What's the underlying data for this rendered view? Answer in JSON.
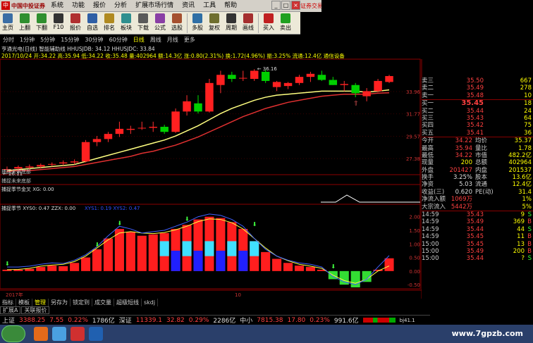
{
  "app": {
    "logo_text": "中国中投证券",
    "broker_badge": "证券交易"
  },
  "menu": [
    "系统",
    "功能",
    "报价",
    "分析",
    "扩展市场行情",
    "资讯",
    "工具",
    "帮助"
  ],
  "toolbar": [
    {
      "label": "主页",
      "color": "#3a6ea5",
      "icon": "home-icon"
    },
    {
      "label": "上翻",
      "color": "#2f8f2f",
      "icon": "page-up-icon"
    },
    {
      "label": "下翻",
      "color": "#2f8f2f",
      "icon": "page-down-icon"
    },
    {
      "label": "F10",
      "color": "#333",
      "icon": "f10-icon"
    },
    {
      "label": "报价",
      "color": "#b03030",
      "icon": "quote-icon"
    },
    {
      "label": "自选",
      "color": "#2f5fa5",
      "icon": "watchlist-icon"
    },
    {
      "label": "排名",
      "color": "#b08a20",
      "icon": "ranking-icon"
    },
    {
      "label": "板块",
      "color": "#2f8f8f",
      "icon": "sector-icon"
    },
    {
      "label": "下载",
      "color": "#5a5a5a",
      "icon": "download-icon"
    },
    {
      "label": "公式",
      "color": "#8a3fa5",
      "icon": "formula-icon"
    },
    {
      "label": "选股",
      "color": "#a5502f",
      "icon": "stock-picker-icon"
    },
    {
      "label": "多股",
      "color": "#2f6fa5",
      "icon": "multi-stock-icon"
    },
    {
      "label": "复权",
      "color": "#6f6f2f",
      "icon": "adjust-icon"
    },
    {
      "label": "周期",
      "color": "#333",
      "icon": "period-icon"
    },
    {
      "label": "画线",
      "color": "#a52f2f",
      "icon": "draw-line-icon"
    },
    {
      "label": "买入",
      "color": "#c02020",
      "icon": "buy-icon"
    },
    {
      "label": "卖出",
      "color": "#20a020",
      "icon": "sell-icon"
    }
  ],
  "periods": [
    "分时",
    "1分钟",
    "5分钟",
    "15分钟",
    "30分钟",
    "60分钟",
    "日线",
    "周线",
    "月线",
    "更多"
  ],
  "active_period": "日线",
  "chart_header": {
    "title_line": "亨通光电(日线) 智能辅助线 HHUSJDB: 34.12  HHUSJDC: 33.84",
    "indicator_line": "2017/10/24 开:34.22 高:35.94 低:34.22 收:35.48 量:402964 额:14.3亿 涨:0.80(2.31%) 换:1.72(4.96%) 振:3.25% 流通:12.4亿 通信设备"
  },
  "price_axis": [
    "33.96",
    "31.77",
    "29.57",
    "27.38"
  ],
  "price_labels": {
    "high": "36.16",
    "low": "26.11"
  },
  "panels": {
    "vol_title": "捕捉未来底部",
    "vol_sub": "捕捉未来底部",
    "golden_title": "捕捉季节金叉 XG: 0.00",
    "season_title": "捕捉季节 XYS0: 0.47  ZZX: 0.00",
    "season_more": "XYS1: 0.19  XYS2: 0.47"
  },
  "osc_axis": [
    "2.00",
    "1.50",
    "1.00",
    "0.50",
    "0.00",
    "-0.50"
  ],
  "time_axis": {
    "year": "2017年",
    "month": "10",
    "period_label": "日线"
  },
  "chart_data": [
    {
      "type": "candlestick",
      "title": "亨通光电(日线)",
      "ylim": [
        25.8,
        37.0
      ],
      "candles": [
        {
          "o": 26.3,
          "h": 26.6,
          "l": 26.0,
          "c": 26.35
        },
        {
          "o": 26.4,
          "h": 26.7,
          "l": 26.2,
          "c": 26.55
        },
        {
          "o": 26.5,
          "h": 26.8,
          "l": 26.3,
          "c": 26.6
        },
        {
          "o": 26.6,
          "h": 26.9,
          "l": 26.4,
          "c": 26.75
        },
        {
          "o": 26.8,
          "h": 27.0,
          "l": 26.6,
          "c": 26.85
        },
        {
          "o": 26.9,
          "h": 27.2,
          "l": 26.7,
          "c": 27.0
        },
        {
          "o": 27.0,
          "h": 27.3,
          "l": 26.8,
          "c": 27.1
        },
        {
          "o": 27.1,
          "h": 29.2,
          "l": 27.0,
          "c": 29.0
        },
        {
          "o": 29.0,
          "h": 29.6,
          "l": 28.6,
          "c": 29.3
        },
        {
          "o": 29.3,
          "h": 30.0,
          "l": 29.0,
          "c": 29.8
        },
        {
          "o": 29.8,
          "h": 31.0,
          "l": 29.5,
          "c": 30.3
        },
        {
          "o": 30.2,
          "h": 30.6,
          "l": 29.8,
          "c": 30.3
        },
        {
          "o": 30.4,
          "h": 31.0,
          "l": 30.2,
          "c": 30.4
        },
        {
          "o": 30.4,
          "h": 31.0,
          "l": 30.0,
          "c": 30.5
        },
        {
          "o": 30.5,
          "h": 30.7,
          "l": 29.8,
          "c": 30.0
        },
        {
          "o": 30.0,
          "h": 32.3,
          "l": 29.9,
          "c": 32.0
        },
        {
          "o": 32.0,
          "h": 33.6,
          "l": 31.6,
          "c": 33.0
        },
        {
          "o": 32.8,
          "h": 33.6,
          "l": 31.8,
          "c": 32.0
        },
        {
          "o": 32.0,
          "h": 35.2,
          "l": 31.9,
          "c": 34.8
        },
        {
          "o": 34.6,
          "h": 36.0,
          "l": 33.8,
          "c": 35.6
        },
        {
          "o": 35.6,
          "h": 35.9,
          "l": 34.9,
          "c": 35.2
        },
        {
          "o": 35.3,
          "h": 36.0,
          "l": 35.0,
          "c": 35.3
        },
        {
          "o": 35.2,
          "h": 36.16,
          "l": 35.0,
          "c": 36.0
        },
        {
          "o": 35.9,
          "h": 36.1,
          "l": 34.8,
          "c": 35.0
        },
        {
          "o": 34.4,
          "h": 35.0,
          "l": 34.0,
          "c": 34.9
        },
        {
          "o": 34.5,
          "h": 34.9,
          "l": 34.2,
          "c": 34.8
        },
        {
          "o": 34.8,
          "h": 35.6,
          "l": 34.6,
          "c": 35.4
        },
        {
          "o": 35.4,
          "h": 35.9,
          "l": 34.9,
          "c": 35.7
        },
        {
          "o": 35.6,
          "h": 36.0,
          "l": 35.0,
          "c": 35.1
        },
        {
          "o": 35.1,
          "h": 35.4,
          "l": 34.6,
          "c": 34.6
        },
        {
          "o": 34.6,
          "h": 35.0,
          "l": 34.0,
          "c": 34.7
        },
        {
          "o": 34.6,
          "h": 34.8,
          "l": 33.4,
          "c": 33.8
        },
        {
          "o": 33.5,
          "h": 34.3,
          "l": 33.0,
          "c": 34.0
        },
        {
          "o": 34.0,
          "h": 35.2,
          "l": 33.9,
          "c": 35.0
        },
        {
          "o": 34.9,
          "h": 35.6,
          "l": 34.8,
          "c": 35.48
        }
      ],
      "ma_series": [
        {
          "name": "HHUSJDB",
          "color": "#ffff80",
          "values": [
            26.2,
            26.3,
            26.4,
            26.5,
            26.6,
            26.7,
            26.8,
            27.1,
            27.4,
            27.7,
            28.0,
            28.3,
            28.6,
            28.9,
            29.2,
            29.6,
            30.1,
            30.6,
            31.2,
            31.8,
            32.3,
            32.7,
            33.1,
            33.4,
            33.6,
            33.7,
            33.8,
            33.9,
            34.0,
            34.0,
            34.0,
            34.0,
            33.9,
            34.0,
            34.12
          ]
        },
        {
          "name": "HHUSJDC",
          "color": "#e03030",
          "values": [
            26.1,
            26.2,
            26.2,
            26.3,
            26.4,
            26.5,
            26.6,
            26.8,
            27.0,
            27.2,
            27.4,
            27.6,
            27.9,
            28.1,
            28.4,
            28.7,
            29.1,
            29.5,
            30.0,
            30.5,
            31.0,
            31.5,
            31.9,
            32.3,
            32.6,
            32.9,
            33.1,
            33.3,
            33.5,
            33.6,
            33.7,
            33.7,
            33.7,
            33.8,
            33.84
          ]
        }
      ]
    },
    {
      "type": "bar",
      "title": "捕捉季节",
      "ylim": [
        -0.6,
        2.2
      ],
      "values": [
        0.05,
        0.05,
        0.08,
        0.15,
        0.2,
        0.18,
        0.3,
        0.5,
        0.8,
        1.2,
        1.55,
        1.45,
        1.3,
        1.35,
        1.4,
        1.55,
        1.7,
        1.9,
        2.0,
        1.95,
        1.8,
        1.55,
        1.1,
        0.7,
        0.45,
        0.3,
        0.2,
        0.15,
        0.05,
        -0.3,
        -0.5,
        -0.6,
        -0.4,
        0.05,
        0.47
      ],
      "line": [
        0.05,
        0.06,
        0.1,
        0.18,
        0.22,
        0.25,
        0.35,
        0.55,
        0.85,
        1.15,
        1.4,
        1.45,
        1.4,
        1.38,
        1.42,
        1.52,
        1.65,
        1.82,
        1.92,
        1.9,
        1.78,
        1.55,
        1.2,
        0.85,
        0.55,
        0.38,
        0.25,
        0.18,
        0.1,
        -0.15,
        -0.35,
        -0.45,
        -0.3,
        0.0,
        0.19
      ]
    }
  ],
  "quote": {
    "asks": [
      {
        "l": "卖三",
        "p": "35.50",
        "v": "667"
      },
      {
        "l": "卖二",
        "p": "35.49",
        "v": "278"
      },
      {
        "l": "卖一",
        "p": "35.48",
        "v": "10"
      }
    ],
    "bids": [
      {
        "l": "买一",
        "p": "35.45",
        "v": "18"
      },
      {
        "l": "买二",
        "p": "35.44",
        "v": "24"
      },
      {
        "l": "买三",
        "p": "35.43",
        "v": "64"
      },
      {
        "l": "买四",
        "p": "35.42",
        "v": "75"
      },
      {
        "l": "买五",
        "p": "35.41",
        "v": "36"
      }
    ],
    "stats": [
      [
        {
          "l": "今开",
          "v": "34.22",
          "c": "red"
        },
        {
          "l": "均价",
          "v": "35.37",
          "c": "red"
        }
      ],
      [
        {
          "l": "最高",
          "v": "35.94",
          "c": "red"
        },
        {
          "l": "量比",
          "v": "1.78",
          "c": "red"
        }
      ],
      [
        {
          "l": "最低",
          "v": "34.22",
          "c": "red"
        },
        {
          "l": "市值",
          "v": "482.2亿",
          "c": "wht"
        }
      ],
      [
        {
          "l": "现量",
          "v": "200",
          "c": "yel"
        },
        {
          "l": "总额",
          "v": "402964",
          "c": "yel"
        }
      ],
      [
        {
          "l": "外盘",
          "v": "201427",
          "c": "red"
        },
        {
          "l": "内盘",
          "v": "201537",
          "c": "grn"
        }
      ],
      [
        {
          "l": "换手",
          "v": "3.25%",
          "c": "wht"
        },
        {
          "l": "股本",
          "v": "13.6亿",
          "c": "wht"
        }
      ],
      [
        {
          "l": "净资",
          "v": "5.03",
          "c": "wht"
        },
        {
          "l": "流通",
          "v": "12.4亿",
          "c": "wht"
        }
      ],
      [
        {
          "l": "收益(三)",
          "v": "0.620",
          "c": "wht"
        },
        {
          "l": "PE(动)",
          "v": "31.4",
          "c": "wht"
        }
      ],
      [
        {
          "l": "净流入额",
          "v": "1069万",
          "c": "red"
        },
        {
          "l": "",
          "v": "1%",
          "c": "red"
        }
      ],
      [
        {
          "l": "大宗流入",
          "v": "5442万",
          "c": "red"
        },
        {
          "l": "",
          "v": "5%",
          "c": "red"
        }
      ]
    ],
    "ticks": [
      {
        "t": "14:59",
        "p": "35.43",
        "v": "9",
        "s": "S"
      },
      {
        "t": "14:59",
        "p": "35.49",
        "v": "369",
        "s": "B"
      },
      {
        "t": "14:59",
        "p": "35.44",
        "v": "44",
        "s": "S"
      },
      {
        "t": "14:59",
        "p": "35.45",
        "v": "11",
        "s": "B"
      },
      {
        "t": "15:00",
        "p": "35.45",
        "v": "13",
        "s": "B"
      },
      {
        "t": "15:00",
        "p": "35.49",
        "v": "200",
        "s": "B"
      },
      {
        "t": "15:00",
        "p": "35.44",
        "v": "?",
        "s": "S"
      }
    ]
  },
  "bottom_tabs": [
    "指标",
    "模板",
    "管理",
    "另存为",
    "锁定到",
    "成交量",
    "超级短线",
    "skdj"
  ],
  "active_bottom_tab": "管理",
  "extra_tabs": [
    "扩展A",
    "关联报价"
  ],
  "statusbar": {
    "sh_label": "上证",
    "sh_val": "3388.25",
    "sh_chg": "7.55",
    "sh_pct": "0.22%",
    "sh_amt": "1786亿",
    "sz_label": "深证",
    "sz_val": "11339.1",
    "sz_chg": "32.82",
    "sz_pct": "0.29%",
    "sz_amt": "2286亿",
    "zx_label": "中小",
    "zx_val": "7815.38",
    "zx_chg": "17.80",
    "zx_pct": "0.23%",
    "zx_amt": "991.6亿",
    "code": "bj41.1"
  },
  "watermark": "www.7gpzb.com"
}
